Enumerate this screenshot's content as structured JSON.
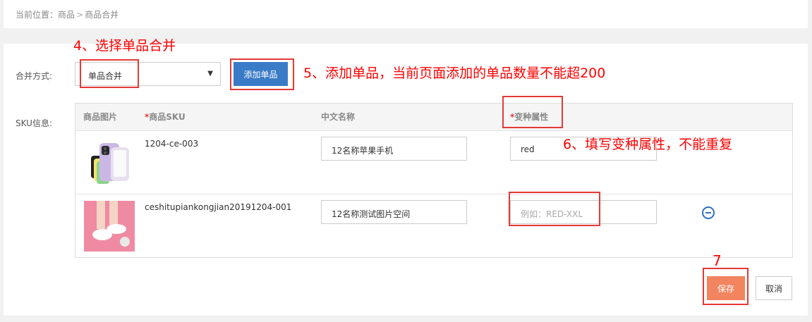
{
  "breadcrumb": {
    "prefix": "当前位置：",
    "item1": "商品",
    "sep": ">",
    "item2": "商品合并"
  },
  "form": {
    "merge_label": "合并方式:",
    "merge_value": "单品合并",
    "add_button": "添加单品",
    "sku_label": "SKU信息:"
  },
  "table": {
    "headers": {
      "image": "商品图片",
      "sku_req": "*",
      "sku": "商品SKU",
      "cn_name": "中文名称",
      "variant_req": "*",
      "variant": "变种属性"
    },
    "rows": [
      {
        "sku": "1204-ce-003",
        "cn_name": "12名称苹果手机",
        "variant": "red",
        "variant_placeholder": ""
      },
      {
        "sku": "ceshitupiankongjian20191204-001",
        "cn_name": "12名称测试图片空间",
        "variant": "",
        "variant_placeholder": "例如：RED-XXL"
      }
    ]
  },
  "actions": {
    "save": "保存",
    "cancel": "取消"
  },
  "annotations": {
    "step4": "4、选择单品合并",
    "step5": "5、添加单品，当前页面添加的单品数量不能超200",
    "step6": "6、填写变种属性，不能重复",
    "step7": "7"
  },
  "colors": {
    "primary": "#3a7bc8",
    "save": "#f2845f",
    "annotation": "#ff0000",
    "required": "#e53935"
  }
}
